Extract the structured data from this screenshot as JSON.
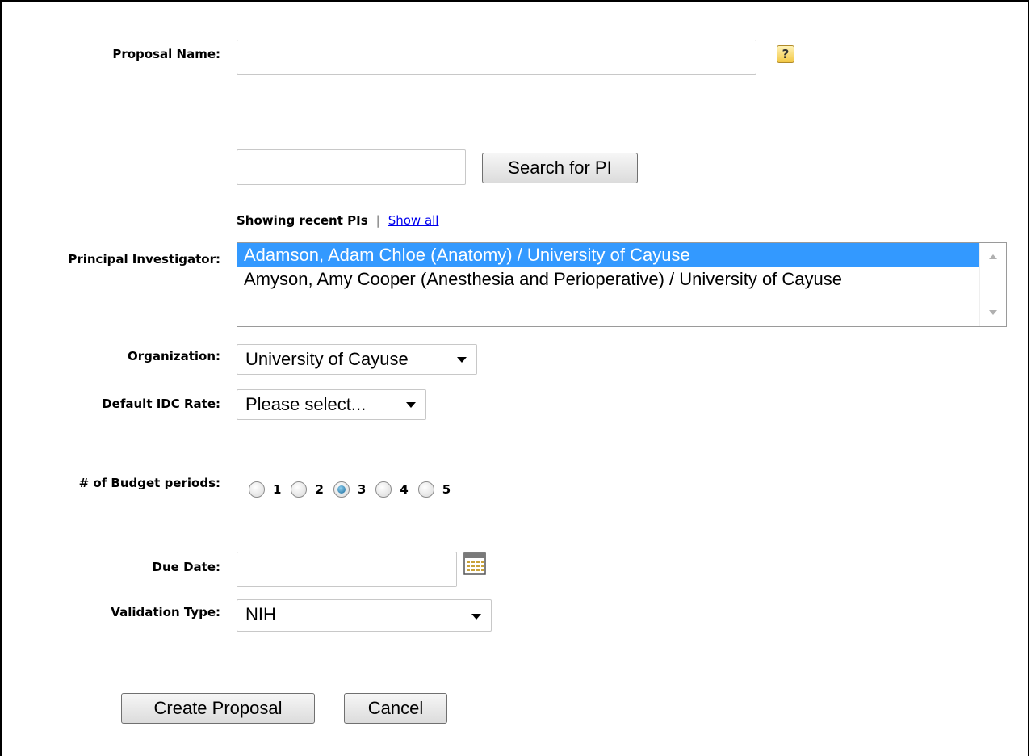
{
  "form": {
    "proposal_name": {
      "label": "Proposal Name:",
      "value": "",
      "help": "?"
    },
    "pi_search": {
      "value": "",
      "button": "Search for PI"
    },
    "recent": {
      "text": "Showing recent PIs",
      "separator": "|",
      "show_all": "Show all"
    },
    "principal_investigator": {
      "label": "Principal Investigator:",
      "options": [
        "Adamson, Adam Chloe (Anatomy) / University of Cayuse",
        "Amyson, Amy Cooper (Anesthesia and Perioperative) / University of Cayuse"
      ],
      "selected_index": 0
    },
    "organization": {
      "label": "Organization:",
      "value": "University of Cayuse"
    },
    "idc_rate": {
      "label": "Default IDC Rate:",
      "value": "Please select..."
    },
    "budget_periods": {
      "label": "# of Budget periods:",
      "options": [
        "1",
        "2",
        "3",
        "4",
        "5"
      ],
      "selected": "3"
    },
    "due_date": {
      "label": "Due Date:",
      "value": ""
    },
    "validation_type": {
      "label": "Validation Type:",
      "value": "NIH"
    }
  },
  "buttons": {
    "create": "Create Proposal",
    "cancel": "Cancel"
  },
  "colors": {
    "selection": "#3399ff",
    "link": "#0000ee"
  },
  "icons": {
    "help": "help-icon",
    "calendar": "calendar-icon"
  }
}
